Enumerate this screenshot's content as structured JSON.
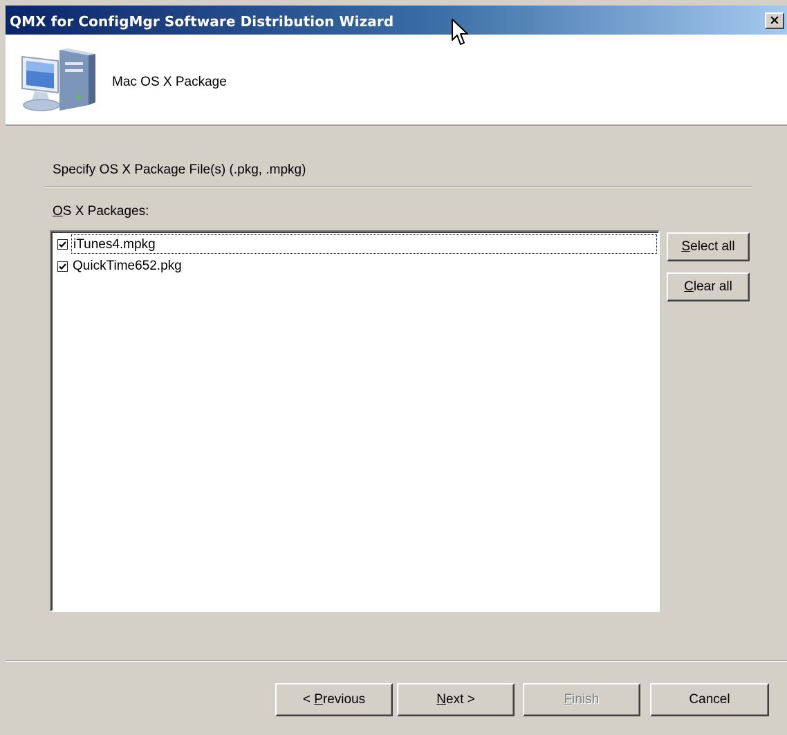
{
  "window": {
    "title": "QMX for ConfigMgr Software Distribution Wizard",
    "close_glyph": "×"
  },
  "header": {
    "title": "Mac OS X Package",
    "icon": "computer-icon"
  },
  "section": {
    "heading": "Specify OS X Package File(s) (.pkg, .mpkg)"
  },
  "packages": {
    "label_accel": "O",
    "label_rest": "S X Packages:",
    "items": [
      {
        "label": "iTunes4.mpkg",
        "checked": true,
        "focused": true
      },
      {
        "label": "QuickTime652.pkg",
        "checked": true,
        "focused": false
      }
    ]
  },
  "side_buttons": {
    "select_all": {
      "accel": "S",
      "rest": "elect all"
    },
    "clear_all": {
      "accel": "C",
      "rest": "lear all"
    }
  },
  "footer": {
    "previous": {
      "pre": "< ",
      "accel": "P",
      "rest": "revious"
    },
    "next": {
      "accel": "N",
      "rest": "ext >"
    },
    "finish": {
      "accel": "F",
      "rest": "inish",
      "disabled": true
    },
    "cancel": {
      "label": "Cancel"
    }
  },
  "colors": {
    "dialog_bg": "#d4d0c8",
    "title_start": "#0a246a",
    "title_end": "#a6caf0"
  }
}
